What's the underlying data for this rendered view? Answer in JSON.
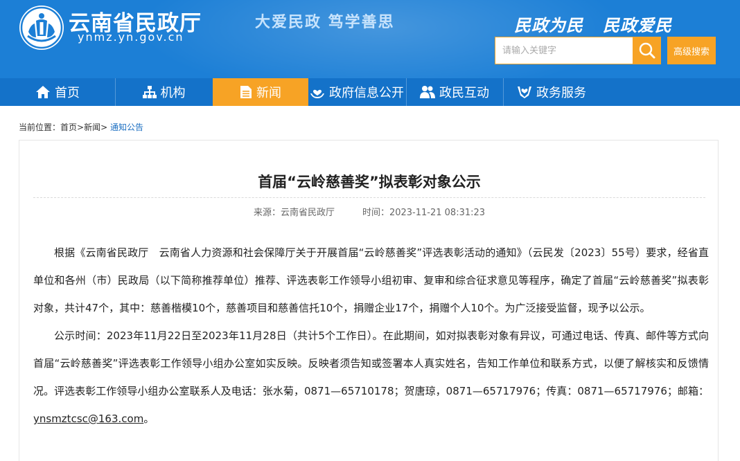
{
  "header": {
    "site_name": "云南省民政厅",
    "site_domain": "ynmz.yn.gov.cn",
    "slogan_center": "大爱民政 笃学善思",
    "slogan_right_1": "民政为民",
    "slogan_right_2": "民政爱民",
    "search_placeholder": "请输入关键字",
    "advanced_search_label": "高级搜索"
  },
  "colors": {
    "header_blue": "#1c7fd6",
    "nav_blue": "#1472c9",
    "accent_orange": "#f7a325",
    "link_blue": "#1c6fc2"
  },
  "nav": {
    "items": [
      {
        "label": "首页",
        "icon": "home-icon"
      },
      {
        "label": "机构",
        "icon": "org-chart-icon"
      },
      {
        "label": "新闻",
        "icon": "document-icon",
        "active": true
      },
      {
        "label": "政府信息公开",
        "icon": "hand-heart-icon"
      },
      {
        "label": "政民互动",
        "icon": "people-icon"
      },
      {
        "label": "政务服务",
        "icon": "heart-hands-icon"
      }
    ]
  },
  "breadcrumb": {
    "prefix": "当前位置：",
    "home": "首页",
    "sep1": ">",
    "news": "新闻",
    "sep2": ">",
    "current": "通知公告"
  },
  "article": {
    "title": "首届“云岭慈善奖”拟表彰对象公示",
    "source": "来源：云南省民政厅",
    "time": "时间：2023-11-21 08:31:23",
    "paragraph1": "根据《云南省民政厅　云南省人力资源和社会保障厅关于开展首届“云岭慈善奖”评选表彰活动的通知》（云民发〔2023〕55号）要求，经省直单位和各州（市）民政局（以下简称推荐单位）推荐、评选表彰工作领导小组初审、复审和综合征求意见等程序，确定了首届“云岭慈善奖”拟表彰对象，共计47个，其中：慈善楷模10个，慈善项目和慈善信托10个，捐赠企业17个，捐赠个人10个。为广泛接受监督，现予以公示。",
    "paragraph2": "公示时间：2023年11月22日至2023年11月28日（共计5个工作日）。在此期间，如对拟表彰对象有异议，可通过电话、传真、邮件等方式向首届“云岭慈善奖”评选表彰工作领导小组办公室如实反映。反映者须告知或签署本人真实姓名，告知工作单位和联系方式，以便了解核实和反馈情况。评选表彰工作领导小组办公室联系人及电话：张水菊，0871—65710178；贺唐琼，0871—65717976；传真：0871—65717976；邮箱：",
    "email": "ynsmztcsc@163.com",
    "paragraph2_end": "。"
  }
}
